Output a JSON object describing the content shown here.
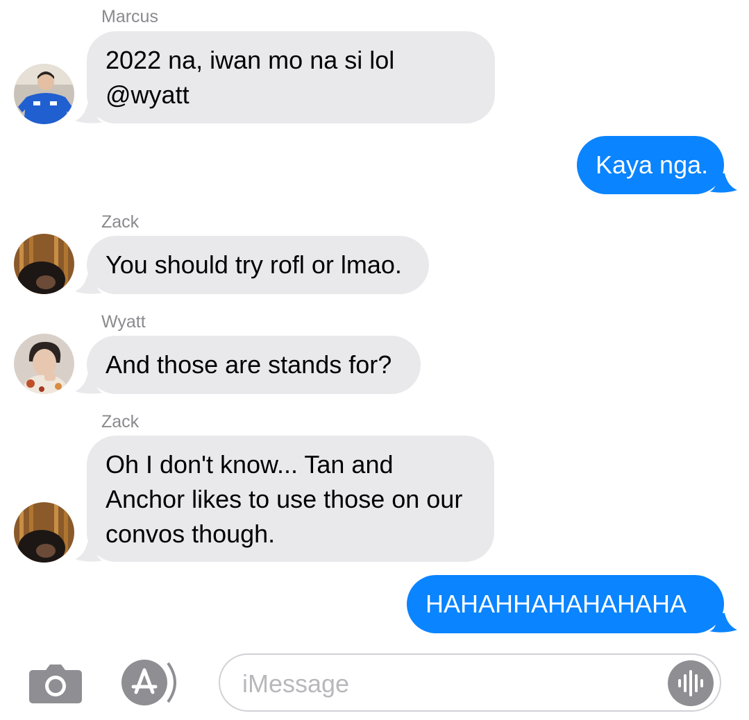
{
  "messages": [
    {
      "sender": "Marcus",
      "lines": [
        "2022 na, iwan mo na si lol",
        "@wyatt"
      ],
      "direction": "incoming"
    },
    {
      "lines": [
        "Kaya nga."
      ],
      "direction": "outgoing"
    },
    {
      "sender": "Zack",
      "lines": [
        "You should try rofl or lmao."
      ],
      "direction": "incoming"
    },
    {
      "sender": "Wyatt",
      "lines": [
        "And those are stands for?"
      ],
      "direction": "incoming"
    },
    {
      "sender": "Zack",
      "lines": [
        "Oh I don't know... Tan and",
        "Anchor likes to use those on our",
        "convos though."
      ],
      "direction": "incoming"
    },
    {
      "lines": [
        "HAHAHHAHAHAHAHA"
      ],
      "direction": "outgoing"
    }
  ],
  "composer": {
    "placeholder": "iMessage",
    "camera_icon": "camera-icon",
    "apps_icon": "app-store-icon",
    "audio_icon": "audio-waveform-icon"
  },
  "colors": {
    "incoming_bubble": "#e9e9eb",
    "outgoing_bubble": "#0a84ff",
    "sender_name": "#8a8a8e"
  }
}
